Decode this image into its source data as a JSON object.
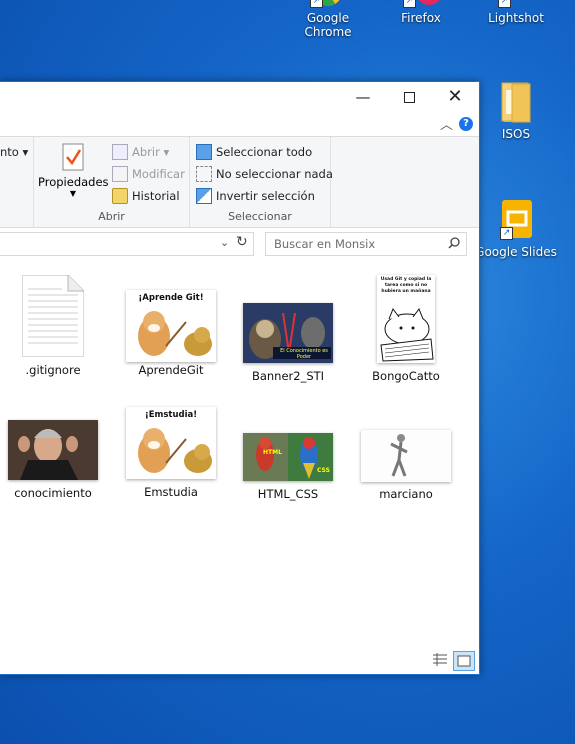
{
  "desktop": {
    "icons": [
      {
        "label": "Google Chrome"
      },
      {
        "label": "Firefox"
      },
      {
        "label": "Lightshot"
      },
      {
        "label": "ISOS"
      },
      {
        "label": "Google Slides"
      }
    ]
  },
  "ribbon": {
    "partial_left_label": "nto",
    "properties_label": "Propiedades",
    "open": {
      "abrir": "Abrir",
      "modificar": "Modificar",
      "historial": "Historial",
      "group_label": "Abrir"
    },
    "select": {
      "all": "Seleccionar todo",
      "none": "No seleccionar nada",
      "invert": "Invertir selección",
      "group_label": "Seleccionar"
    }
  },
  "search": {
    "placeholder": "Buscar en Monsix"
  },
  "files": [
    {
      "name": ".gitignore",
      "kind": "text"
    },
    {
      "name": "AprendeGit",
      "kind": "meme",
      "caption": "¡Aprende Git!"
    },
    {
      "name": "Banner2_STI",
      "kind": "banner",
      "caption": "El Conocimiento es Poder"
    },
    {
      "name": "BongoCatto",
      "kind": "comic",
      "caption": "Usad Git y copiad la tarea como si no hubiera un mañana"
    },
    {
      "name": "conocimiento",
      "kind": "photo"
    },
    {
      "name": "Emstudia",
      "kind": "meme",
      "caption": "¡Emstudia!"
    },
    {
      "name": "HTML_CSS",
      "kind": "parrots",
      "caption_left": "HTML",
      "caption_right": "CSS"
    },
    {
      "name": "marciano",
      "kind": "dancer"
    }
  ],
  "colors": {
    "accent": "#1a73e8",
    "window_border": "#1c6fcf"
  }
}
